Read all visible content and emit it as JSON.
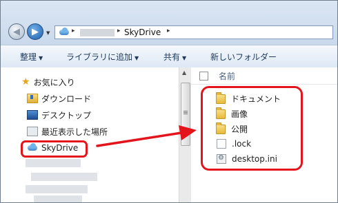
{
  "address_bar": {
    "segments": [
      "SkyDrive"
    ],
    "separator": "▸",
    "dropdown": "▸"
  },
  "toolbar": {
    "organize": "整理",
    "add_library": "ライブラリに追加",
    "share": "共有",
    "new_folder": "新しいフォルダー",
    "dropdown_glyph": "▼"
  },
  "sidebar": {
    "favorites_label": "お気に入り",
    "items": [
      {
        "label": "ダウンロード",
        "icon": "download-folder-icon"
      },
      {
        "label": "デスクトップ",
        "icon": "desktop-icon"
      },
      {
        "label": "最近表示した場所",
        "icon": "recent-places-icon"
      },
      {
        "label": "SkyDrive",
        "icon": "skydrive-icon"
      }
    ]
  },
  "content": {
    "column_name": "名前",
    "files": [
      {
        "name": "ドキュメント",
        "icon": "folder-icon"
      },
      {
        "name": "画像",
        "icon": "folder-icon"
      },
      {
        "name": "公開",
        "icon": "folder-icon"
      },
      {
        "name": ".lock",
        "icon": "file-icon"
      },
      {
        "name": "desktop.ini",
        "icon": "settings-file-icon"
      }
    ]
  },
  "colors": {
    "annotation_red": "#e3141b",
    "toolbar_text": "#1e395b"
  }
}
